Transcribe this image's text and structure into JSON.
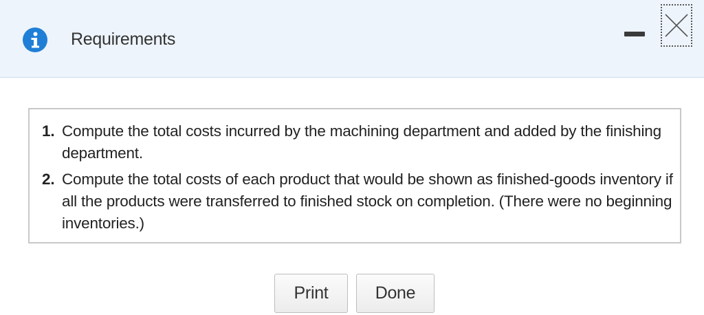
{
  "dialog": {
    "title": "Requirements",
    "icons": {
      "info": "info-icon",
      "minimize": "minimize-icon",
      "close": "close-icon"
    }
  },
  "requirements": [
    {
      "number": "1.",
      "text": "Compute the total costs incurred by the machining department and added by the finishing department."
    },
    {
      "number": "2.",
      "text": "Compute the total costs of each product that would be shown as finished-goods inventory if all the products were transferred to finished stock on completion. (There were no beginning inventories.)"
    }
  ],
  "buttons": {
    "print_label": "Print",
    "done_label": "Done"
  },
  "colors": {
    "header_bg": "#edf4fb",
    "accent": "#1f7fd6"
  }
}
